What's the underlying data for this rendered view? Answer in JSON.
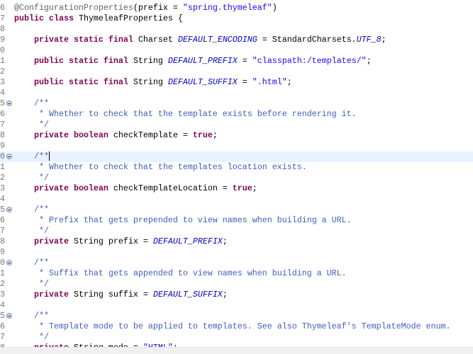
{
  "editor": {
    "current_line": 14,
    "lines": [
      {
        "n": "6",
        "html": "<span class='ann'>@ConfigurationProperties</span>(prefix = <span class='str'>\"spring.thymeleaf\"</span>)"
      },
      {
        "n": "7",
        "html": "<span class='kw'>public class</span> ThymeleafProperties {"
      },
      {
        "n": "8",
        "html": ""
      },
      {
        "n": "9",
        "html": "    <span class='kw'>private static final</span> Charset <span class='const'>DEFAULT_ENCODING</span> = StandardCharsets.<span class='const'>UTF_8</span>;"
      },
      {
        "n": "0",
        "html": ""
      },
      {
        "n": "1",
        "html": "    <span class='kw'>public static final</span> String <span class='const'>DEFAULT_PREFIX</span> = <span class='str'>\"classpath:/templates/\"</span>;"
      },
      {
        "n": "2",
        "html": ""
      },
      {
        "n": "3",
        "html": "    <span class='kw'>public static final</span> String <span class='const'>DEFAULT_SUFFIX</span> = <span class='str'>\".html\"</span>;"
      },
      {
        "n": "4",
        "html": ""
      },
      {
        "n": "5",
        "fold": true,
        "html": "    <span class='cm'>/**</span>"
      },
      {
        "n": "6",
        "html": "<span class='cm'>     * Whether to check that the template exists before rendering it.</span>"
      },
      {
        "n": "7",
        "html": "<span class='cm'>     */</span>"
      },
      {
        "n": "8",
        "html": "    <span class='kw'>private boolean</span> checkTemplate = <span class='kw'>true</span>;"
      },
      {
        "n": "9",
        "html": ""
      },
      {
        "n": "0",
        "fold": true,
        "html": "    <span class='cm'>/**</span><span class='caret'></span>"
      },
      {
        "n": "1",
        "html": "<span class='cm'>     * Whether to check that the templates location exists.</span>"
      },
      {
        "n": "2",
        "html": "<span class='cm'>     */</span>"
      },
      {
        "n": "3",
        "html": "    <span class='kw'>private boolean</span> checkTemplateLocation = <span class='kw'>true</span>;"
      },
      {
        "n": "4",
        "html": ""
      },
      {
        "n": "5",
        "fold": true,
        "html": "    <span class='cm'>/**</span>"
      },
      {
        "n": "6",
        "html": "<span class='cm'>     * Prefix that gets prepended to view names when building a URL.</span>"
      },
      {
        "n": "7",
        "html": "<span class='cm'>     */</span>"
      },
      {
        "n": "8",
        "html": "    <span class='kw'>private</span> String prefix = <span class='const'>DEFAULT_PREFIX</span>;"
      },
      {
        "n": "9",
        "html": ""
      },
      {
        "n": "0",
        "fold": true,
        "html": "    <span class='cm'>/**</span>"
      },
      {
        "n": "1",
        "html": "<span class='cm'>     * Suffix that gets appended to view names when building a URL.</span>"
      },
      {
        "n": "2",
        "html": "<span class='cm'>     */</span>"
      },
      {
        "n": "3",
        "html": "    <span class='kw'>private</span> String suffix = <span class='const'>DEFAULT_SUFFIX</span>;"
      },
      {
        "n": "4",
        "html": ""
      },
      {
        "n": "5",
        "fold": true,
        "html": "    <span class='cm'>/**</span>"
      },
      {
        "n": "6",
        "html": "<span class='cm'>     * Template mode to be applied to templates. See also Thymeleaf's TemplateMode enum.</span>"
      },
      {
        "n": "7",
        "html": "<span class='cm'>     */</span>"
      },
      {
        "n": "8",
        "html": "    <span class='kw'>private</span> String mode = <span class='str'>\"HTML\"</span>;"
      }
    ]
  }
}
